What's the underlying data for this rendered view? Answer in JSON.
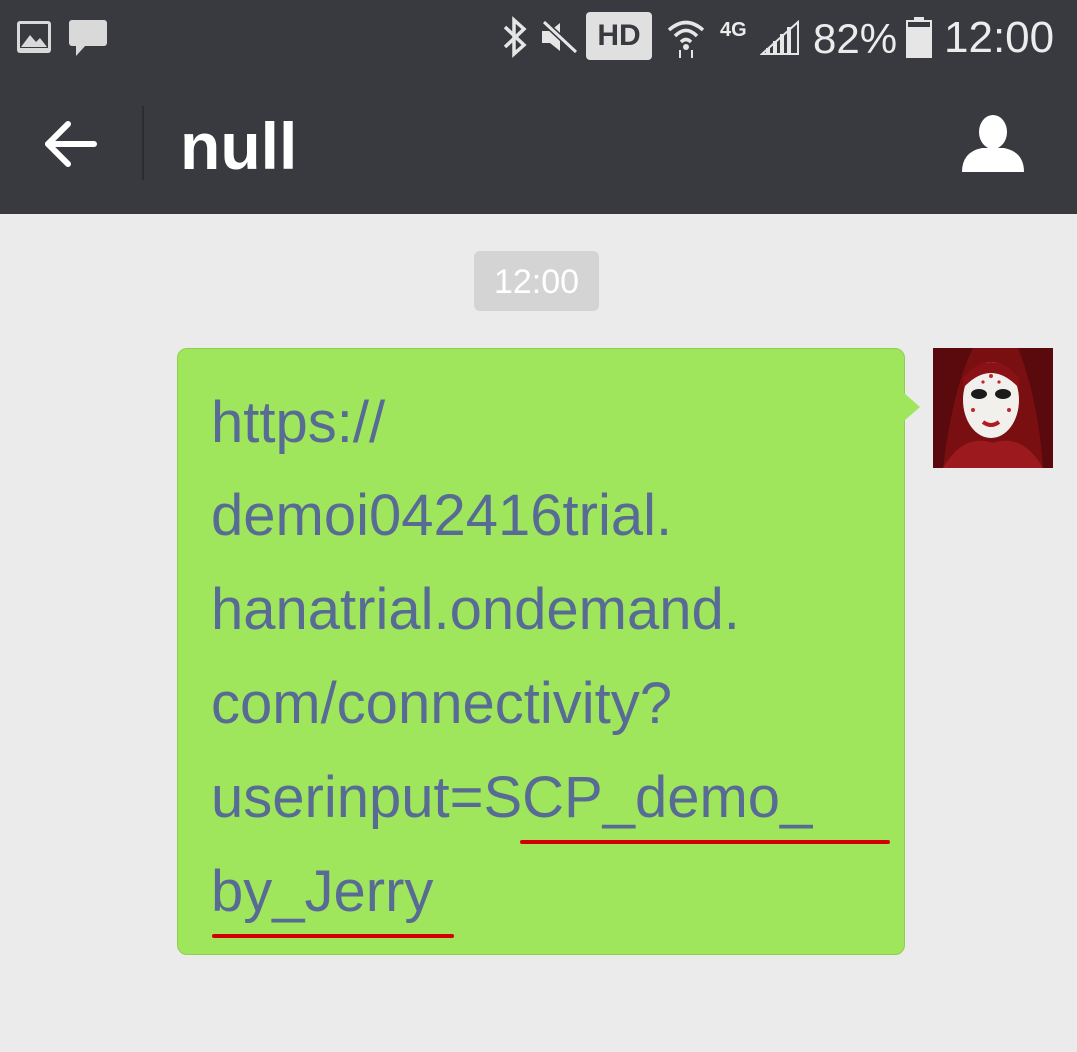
{
  "status_bar": {
    "battery_percent": "82%",
    "time": "12:00",
    "network_badge": "HD",
    "network_type": "4G",
    "icons": [
      "image-icon",
      "message-icon",
      "bluetooth-icon",
      "vibrate-mute-icon",
      "wifi-icon",
      "signal-icon",
      "battery-icon"
    ]
  },
  "title_bar": {
    "title": "null",
    "back_icon": "arrow-left-icon",
    "contact_icon": "person-icon"
  },
  "chat": {
    "timestamp": "12:00",
    "message": {
      "lines": [
        "https://",
        "demoi042416trial.",
        "hanatrial.ondemand.",
        "com/connectivity?",
        "userinput=SCP_demo_",
        "by_Jerry"
      ],
      "highlight_color": "#d40000",
      "bubble_color": "#a0e65c",
      "text_color": "#576b95"
    },
    "avatar_icon": "mask-avatar-icon"
  }
}
